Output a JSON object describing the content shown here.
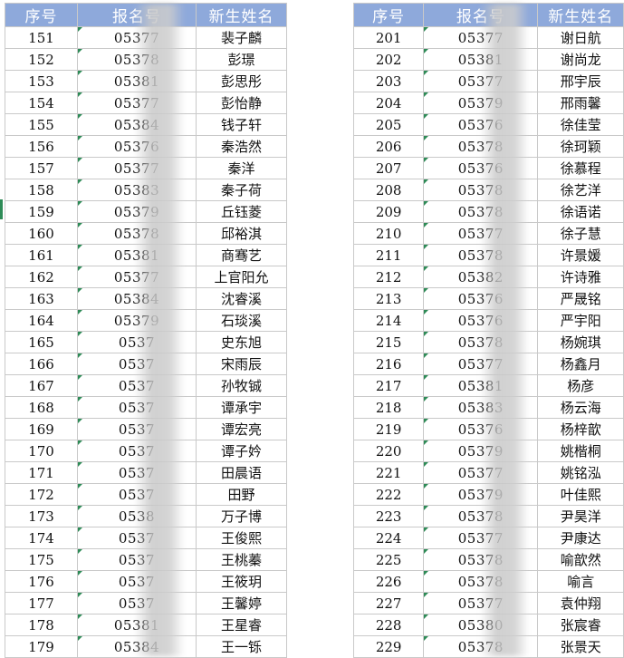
{
  "headers": {
    "seq": "序号",
    "reg": "报名号",
    "name": "新生姓名"
  },
  "left_rows": [
    {
      "seq": "151",
      "reg": "05377",
      "name": "裴子麟"
    },
    {
      "seq": "152",
      "reg": "05378",
      "name": "彭璟"
    },
    {
      "seq": "153",
      "reg": "05381",
      "name": "彭思彤"
    },
    {
      "seq": "154",
      "reg": "05377",
      "name": "彭怡静"
    },
    {
      "seq": "155",
      "reg": "05384",
      "name": "钱子轩"
    },
    {
      "seq": "156",
      "reg": "05376",
      "name": "秦浩然"
    },
    {
      "seq": "157",
      "reg": "05377",
      "name": "秦洋"
    },
    {
      "seq": "158",
      "reg": "05383",
      "name": "秦子荷"
    },
    {
      "seq": "159",
      "reg": "05379",
      "name": "丘钰菱"
    },
    {
      "seq": "160",
      "reg": "05378",
      "name": "邱裕淇"
    },
    {
      "seq": "161",
      "reg": "05381",
      "name": "商骞艺"
    },
    {
      "seq": "162",
      "reg": "05377",
      "name": "上官阳允"
    },
    {
      "seq": "163",
      "reg": "05384",
      "name": "沈睿溪"
    },
    {
      "seq": "164",
      "reg": "05379",
      "name": "石琰溪"
    },
    {
      "seq": "165",
      "reg": "0537",
      "name": "史东旭"
    },
    {
      "seq": "166",
      "reg": "0537",
      "name": "宋雨辰"
    },
    {
      "seq": "167",
      "reg": "0537",
      "name": "孙牧铖"
    },
    {
      "seq": "168",
      "reg": "0537",
      "name": "谭承宇"
    },
    {
      "seq": "169",
      "reg": "0537",
      "name": "谭宏亮"
    },
    {
      "seq": "170",
      "reg": "0537",
      "name": "谭子妗"
    },
    {
      "seq": "171",
      "reg": "0537",
      "name": "田晨语"
    },
    {
      "seq": "172",
      "reg": "0537",
      "name": "田野"
    },
    {
      "seq": "173",
      "reg": "0538",
      "name": "万子博"
    },
    {
      "seq": "174",
      "reg": "0537",
      "name": "王俊熙"
    },
    {
      "seq": "175",
      "reg": "0537",
      "name": "王桃蓁"
    },
    {
      "seq": "176",
      "reg": "0537",
      "name": "王筱玥"
    },
    {
      "seq": "177",
      "reg": "0537",
      "name": "王馨婷"
    },
    {
      "seq": "178",
      "reg": "05381",
      "name": "王星睿"
    },
    {
      "seq": "179",
      "reg": "05384",
      "name": "王一铄"
    }
  ],
  "right_rows": [
    {
      "seq": "201",
      "reg": "05377",
      "name": "谢日航"
    },
    {
      "seq": "202",
      "reg": "05381",
      "name": "谢尚龙"
    },
    {
      "seq": "203",
      "reg": "05377",
      "name": "邢宇辰"
    },
    {
      "seq": "204",
      "reg": "05379",
      "name": "邢雨馨"
    },
    {
      "seq": "205",
      "reg": "05376",
      "name": "徐佳莹"
    },
    {
      "seq": "206",
      "reg": "05378",
      "name": "徐珂颖"
    },
    {
      "seq": "207",
      "reg": "05376",
      "name": "徐慕程"
    },
    {
      "seq": "208",
      "reg": "05378",
      "name": "徐艺洋"
    },
    {
      "seq": "209",
      "reg": "05378",
      "name": "徐语诺"
    },
    {
      "seq": "210",
      "reg": "05377",
      "name": "徐子慧"
    },
    {
      "seq": "211",
      "reg": "05378",
      "name": "许景媛"
    },
    {
      "seq": "212",
      "reg": "05382",
      "name": "许诗雅"
    },
    {
      "seq": "213",
      "reg": "05376",
      "name": "严晟铭"
    },
    {
      "seq": "214",
      "reg": "05376",
      "name": "严宇阳"
    },
    {
      "seq": "215",
      "reg": "05378",
      "name": "杨婉琪"
    },
    {
      "seq": "216",
      "reg": "05377",
      "name": "杨鑫月"
    },
    {
      "seq": "217",
      "reg": "05381",
      "name": "杨彦"
    },
    {
      "seq": "218",
      "reg": "05383",
      "name": "杨云海"
    },
    {
      "seq": "219",
      "reg": "05376",
      "name": "杨梓歆"
    },
    {
      "seq": "220",
      "reg": "05379",
      "name": "姚楷桐"
    },
    {
      "seq": "221",
      "reg": "05377",
      "name": "姚铭泓"
    },
    {
      "seq": "222",
      "reg": "05379",
      "name": "叶佳熙"
    },
    {
      "seq": "223",
      "reg": "05378",
      "name": "尹昊洋"
    },
    {
      "seq": "224",
      "reg": "05377",
      "name": "尹康达"
    },
    {
      "seq": "225",
      "reg": "05378",
      "name": "喻歆然"
    },
    {
      "seq": "226",
      "reg": "05378",
      "name": "喻言"
    },
    {
      "seq": "227",
      "reg": "05377",
      "name": "袁仲翔"
    },
    {
      "seq": "228",
      "reg": "05380",
      "name": "张宸睿"
    },
    {
      "seq": "229",
      "reg": "05378",
      "name": "张景天"
    }
  ]
}
